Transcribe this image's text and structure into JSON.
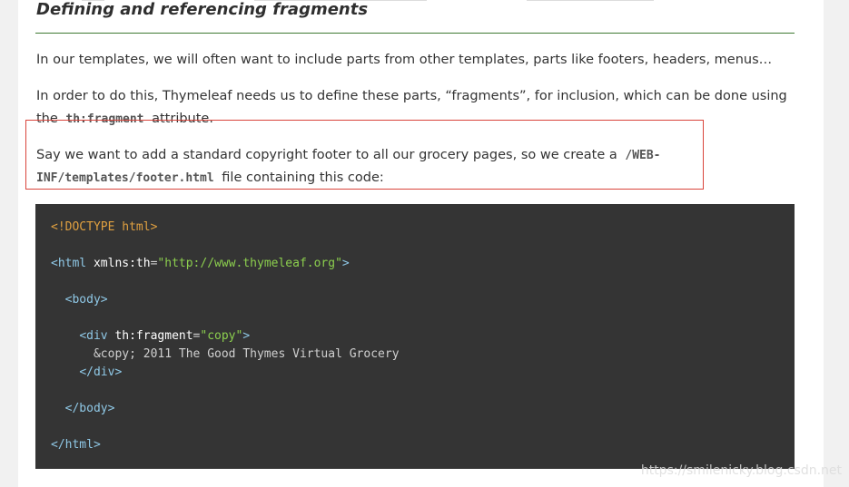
{
  "section": {
    "heading": "Defining and referencing fragments"
  },
  "paragraphs": {
    "p1": "In our templates, we will often want to include parts from other templates, parts like footers, headers, menus…",
    "p2_before": "In order to do this, Thymeleaf needs us to define these parts, “fragments”, for inclusion, which can be done using the ",
    "p2_code": "th:fragment",
    "p2_after": " attribute.",
    "p3_before": "Say we want to add a standard copyright footer to all our grocery pages, so we create a ",
    "p3_code": "/WEB-INF/templates/footer.html",
    "p3_after": " file containing this code:"
  },
  "code": {
    "doctype": "<!DOCTYPE html>",
    "html_open": "<html",
    "html_attr": "xmlns:th",
    "html_eq": "=",
    "html_val": "\"http://www.thymeleaf.org\"",
    "html_close_bracket": ">",
    "body_open": "<body>",
    "div_open": "<div",
    "div_attr": "th:fragment",
    "div_eq": "=",
    "div_val": "\"copy\"",
    "div_close_bracket": ">",
    "content_text": "&copy; 2011 The Good Thymes Virtual Grocery",
    "div_close": "</div>",
    "body_close": "</body>",
    "html_close": "</html>"
  },
  "watermark": "https://smilenicky.blog.csdn.net"
}
